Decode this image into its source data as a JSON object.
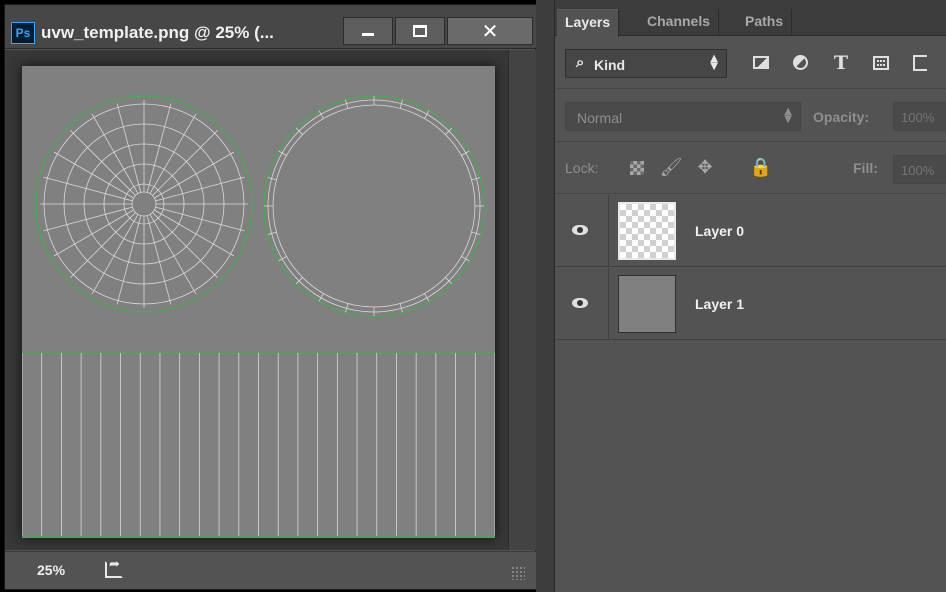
{
  "document": {
    "app_badge": "Ps",
    "title": "uvw_template.png @ 25% (...",
    "close_glyph": "✕",
    "zoom": "25%"
  },
  "layers_panel": {
    "tabs": [
      {
        "label": "Layers",
        "active": true
      },
      {
        "label": "Channels",
        "active": false
      },
      {
        "label": "Paths",
        "active": false
      }
    ],
    "filter": {
      "kind_label": "Kind",
      "kind_icon": "search-icon",
      "type_icon_glyph": "T"
    },
    "blend_mode": "Normal",
    "opacity_label": "Opacity:",
    "opacity_value": "100%",
    "lock_label": "Lock:",
    "fill_label": "Fill:",
    "fill_value": "100%",
    "lock_glyphs": {
      "image": "🖌",
      "position": "✥",
      "all": "🔒"
    },
    "layers": [
      {
        "name": "Layer 0",
        "visible": true,
        "thumbnail": "transparent"
      },
      {
        "name": "Layer 1",
        "visible": true,
        "thumbnail": "gray"
      }
    ]
  },
  "colors": {
    "panel_bg": "#535353",
    "canvas_fill": "#808080",
    "uv_green": "#3fb04a",
    "uv_wire": "#d8d8d8"
  }
}
